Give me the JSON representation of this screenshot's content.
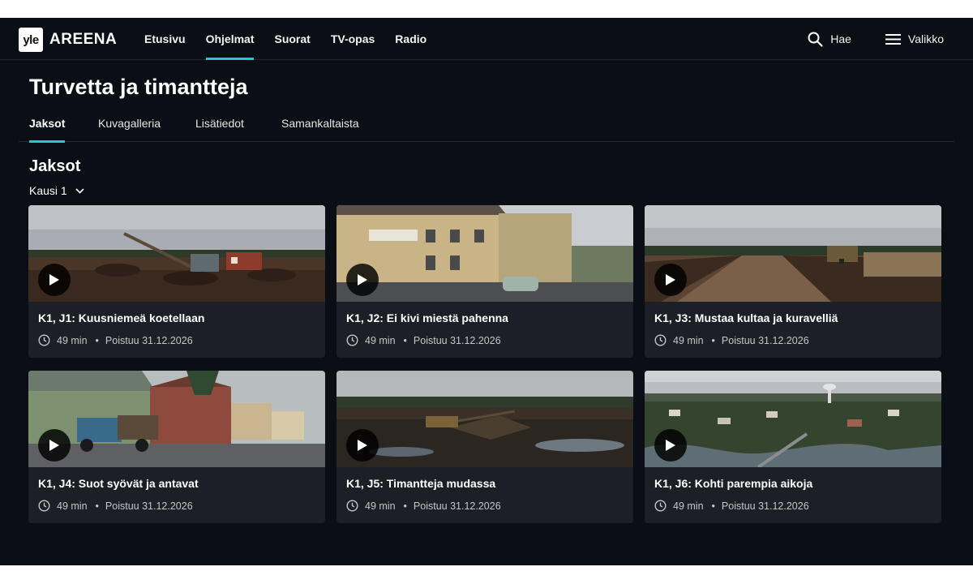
{
  "header": {
    "logo_mark": "yle",
    "logo_text": "AREENA",
    "nav": [
      "Etusivu",
      "Ohjelmat",
      "Suorat",
      "TV-opas",
      "Radio"
    ],
    "active_nav": "Ohjelmat",
    "search_label": "Hae",
    "search_icon": "search-icon",
    "menu_label": "Valikko",
    "menu_icon": "hamburger-menu-icon"
  },
  "page": {
    "title": "Turvetta ja timantteja",
    "tabs": [
      "Jaksot",
      "Kuvagalleria",
      "Lisätiedot",
      "Samankaltaista"
    ],
    "active_tab": "Jaksot"
  },
  "episodes_section": {
    "title": "Jaksot",
    "season_selector": "Kausi 1",
    "season_icon": "chevron-down-icon",
    "items": [
      {
        "title": "K1, J1: Kuusniemeä koetellaan",
        "duration": "49 min",
        "expires": "Poistuu 31.12.2026",
        "thumbnail": "peat-bog-machinery"
      },
      {
        "title": "K1, J2: Ei kivi miestä pahenna",
        "duration": "49 min",
        "expires": "Poistuu 31.12.2026",
        "thumbnail": "village-cooperative-store"
      },
      {
        "title": "K1, J3: Mustaa kultaa ja kuravelliä",
        "duration": "49 min",
        "expires": "Poistuu 31.12.2026",
        "thumbnail": "peat-field-harvester"
      },
      {
        "title": "K1, J4: Suot syövät ja antavat",
        "duration": "49 min",
        "expires": "Poistuu 31.12.2026",
        "thumbnail": "old-truck-village-street"
      },
      {
        "title": "K1, J5: Timantteja mudassa",
        "duration": "49 min",
        "expires": "Poistuu 31.12.2026",
        "thumbnail": "muddy-excavation-site"
      },
      {
        "title": "K1, J6: Kohti parempia aikoja",
        "duration": "49 min",
        "expires": "Poistuu 31.12.2026",
        "thumbnail": "aerial-town-river"
      }
    ]
  },
  "colors": {
    "background": "#0b0e15",
    "card": "#1c1f26",
    "accent": "#2cc5c9"
  }
}
